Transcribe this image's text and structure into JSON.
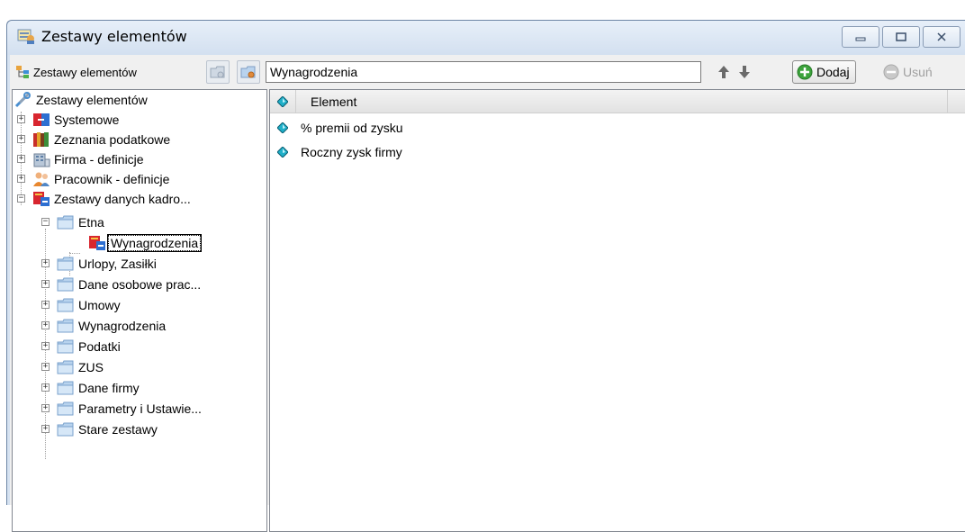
{
  "window": {
    "title": "Zestawy elementów"
  },
  "toolbar": {
    "root_label": "Zestawy elementów",
    "path_value": "Wynagrodzenia",
    "add_label": "Dodaj",
    "remove_label": "Usuń"
  },
  "tree": {
    "root": "Zestawy elementów",
    "items": [
      {
        "label": "Systemowe"
      },
      {
        "label": "Zeznania podatkowe"
      },
      {
        "label": "Firma - definicje"
      },
      {
        "label": "Pracownik - definicje"
      },
      {
        "label": "Zestawy danych kadro..."
      },
      {
        "label": "Etna"
      },
      {
        "label": "Wynagrodzenia"
      },
      {
        "label": "Urlopy, Zasiłki"
      },
      {
        "label": "Dane osobowe prac..."
      },
      {
        "label": "Umowy"
      },
      {
        "label": "Wynagrodzenia"
      },
      {
        "label": "Podatki"
      },
      {
        "label": "ZUS"
      },
      {
        "label": "Dane firmy"
      },
      {
        "label": "Parametry i Ustawie..."
      },
      {
        "label": "Stare zestawy"
      }
    ]
  },
  "list": {
    "column_header": "Element",
    "rows": [
      {
        "label": "% premii od zysku"
      },
      {
        "label": "Roczny zysk firmy"
      }
    ]
  },
  "colors": {
    "accent_teal": "#1fb0c9",
    "folder": "#b8d3ee",
    "add_green": "#3da33d"
  }
}
